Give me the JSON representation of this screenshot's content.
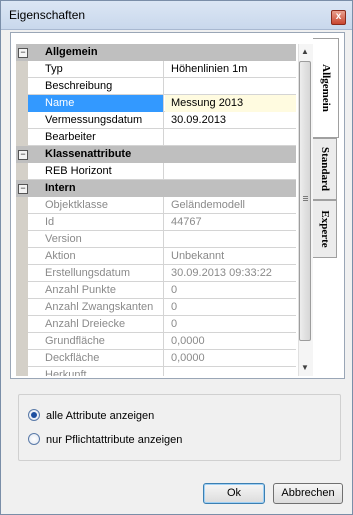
{
  "window": {
    "title": "Eigenschaften",
    "close_glyph": "x"
  },
  "tabs": [
    {
      "label": "Allgemein",
      "active": true
    },
    {
      "label": "Standard",
      "active": false
    },
    {
      "label": "Experte",
      "active": false
    }
  ],
  "grid": {
    "collapse_glyph": "−",
    "rows": [
      {
        "kind": "category",
        "name": "Allgemein"
      },
      {
        "kind": "property",
        "name": "Typ",
        "value": "Höhenlinien 1m",
        "readonly": false,
        "selected": false
      },
      {
        "kind": "property",
        "name": "Beschreibung",
        "value": "",
        "readonly": false,
        "selected": false
      },
      {
        "kind": "property",
        "name": "Name",
        "value": "Messung 2013",
        "readonly": false,
        "selected": true
      },
      {
        "kind": "property",
        "name": "Vermessungsdatum",
        "value": "30.09.2013",
        "readonly": false,
        "selected": false
      },
      {
        "kind": "property",
        "name": "Bearbeiter",
        "value": "",
        "readonly": false,
        "selected": false
      },
      {
        "kind": "category",
        "name": "Klassenattribute"
      },
      {
        "kind": "property",
        "name": "REB Horizont",
        "value": "",
        "readonly": false,
        "selected": false
      },
      {
        "kind": "category",
        "name": "Intern"
      },
      {
        "kind": "property",
        "name": "Objektklasse",
        "value": "Geländemodell",
        "readonly": true,
        "selected": false
      },
      {
        "kind": "property",
        "name": "Id",
        "value": "44767",
        "readonly": true,
        "selected": false
      },
      {
        "kind": "property",
        "name": "Version",
        "value": "",
        "readonly": true,
        "selected": false
      },
      {
        "kind": "property",
        "name": "Aktion",
        "value": "Unbekannt",
        "readonly": true,
        "selected": false
      },
      {
        "kind": "property",
        "name": "Erstellungsdatum",
        "value": "30.09.2013 09:33:22",
        "readonly": true,
        "selected": false
      },
      {
        "kind": "property",
        "name": "Anzahl Punkte",
        "value": "0",
        "readonly": true,
        "selected": false
      },
      {
        "kind": "property",
        "name": "Anzahl Zwangskanten",
        "value": "0",
        "readonly": true,
        "selected": false
      },
      {
        "kind": "property",
        "name": "Anzahl Dreiecke",
        "value": "0",
        "readonly": true,
        "selected": false
      },
      {
        "kind": "property",
        "name": "Grundfläche",
        "value": "0,0000",
        "readonly": true,
        "selected": false
      },
      {
        "kind": "property",
        "name": "Deckfläche",
        "value": "0,0000",
        "readonly": true,
        "selected": false
      },
      {
        "kind": "property",
        "name": "Herkunft",
        "value": "",
        "readonly": true,
        "selected": false
      }
    ]
  },
  "filter": {
    "options": [
      {
        "label": "alle Attribute anzeigen",
        "checked": true
      },
      {
        "label": "nur Pflichtattribute anzeigen",
        "checked": false
      }
    ]
  },
  "buttons": {
    "ok_label": "Ok",
    "cancel_label": "Abbrechen"
  },
  "icons": {
    "scroll_up": "scroll-up-arrow-icon",
    "scroll_down": "scroll-down-arrow-icon",
    "close": "close-icon",
    "collapse": "collapse-minus-icon"
  },
  "colors": {
    "selection": "#3399ff",
    "category_band": "#bfbfbf",
    "readonly_text": "#8a8a8a",
    "edit_value_bg": "#fffbe0"
  }
}
